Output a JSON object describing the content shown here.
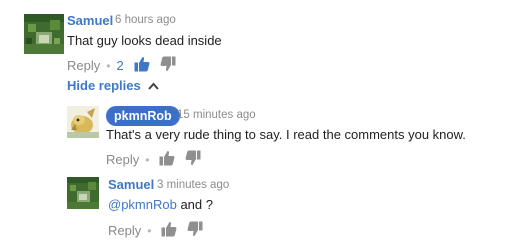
{
  "comment": {
    "author": "Samuel",
    "time": "6 hours ago",
    "text": "That guy looks dead inside",
    "reply_label": "Reply",
    "like_count": "2",
    "hide_replies_label": "Hide replies"
  },
  "replies": [
    {
      "author": "pkmnRob",
      "time": "15 minutes ago",
      "text": "That's a very rude thing to say. I read the comments you know.",
      "reply_label": "Reply"
    },
    {
      "author": "Samuel",
      "time": "3 minutes ago",
      "mention": "@pkmnRob",
      "text_rest": " and ?",
      "reply_label": "Reply"
    }
  ],
  "colors": {
    "accent": "#3f78c6",
    "owner_badge": "#3b6fc8",
    "like_active": "#3f78c6",
    "muted_icon": "#909090"
  }
}
